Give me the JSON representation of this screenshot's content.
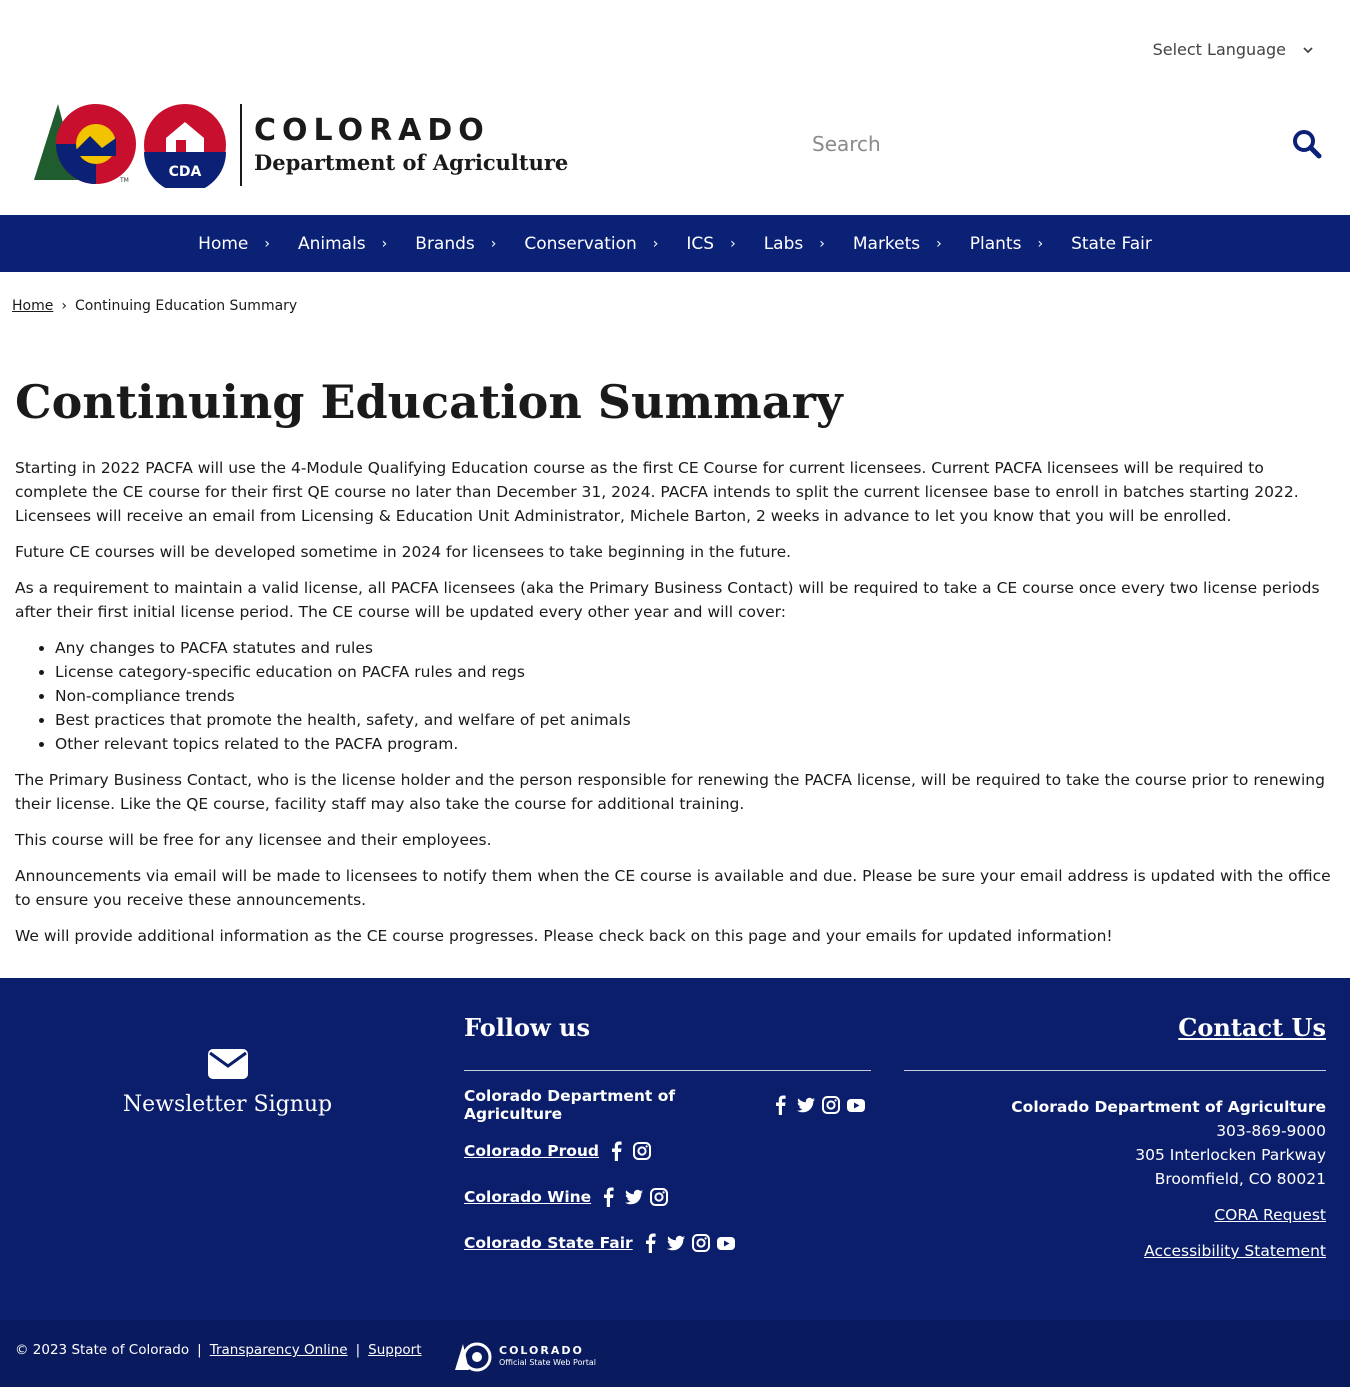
{
  "language": {
    "label": "Select Language"
  },
  "brand": {
    "name": "COLORADO",
    "dept": "Department of Agriculture",
    "badge": "CDA",
    "tm": "TM"
  },
  "search": {
    "placeholder": "Search"
  },
  "nav": {
    "items": [
      {
        "label": "Home"
      },
      {
        "label": "Animals"
      },
      {
        "label": "Brands"
      },
      {
        "label": "Conservation"
      },
      {
        "label": "ICS"
      },
      {
        "label": "Labs"
      },
      {
        "label": "Markets"
      },
      {
        "label": "Plants"
      },
      {
        "label": "State Fair"
      }
    ]
  },
  "breadcrumb": {
    "home": "Home",
    "current": "Continuing Education Summary"
  },
  "page": {
    "title": "Continuing Education Summary",
    "p1": "Starting in 2022 PACFA will use the 4-Module Qualifying Education course as the first CE Course for current licensees. Current PACFA licensees will be required to complete the CE course for their first QE course no later than December 31, 2024. PACFA intends to split the current licensee base to enroll in batches starting 2022.  Licensees will receive an email from Licensing & Education Unit Administrator, Michele Barton, 2 weeks in advance to let you know that you will be enrolled.",
    "p2": "Future CE courses will be developed sometime in 2024 for licensees to take beginning in the future.",
    "p3": "As a requirement to maintain a valid license, all PACFA licensees (aka the Primary Business Contact) will be required to take a CE course once every two license periods after their first initial license period. The CE course will be updated every other year and will cover:",
    "list": [
      "Any changes to PACFA statutes and rules",
      "License category-specific education on PACFA rules and regs",
      "Non-compliance trends",
      "Best practices that promote the health, safety, and welfare of pet animals",
      "Other relevant topics related to the PACFA program."
    ],
    "p4": "The Primary Business Contact, who is the license holder and the person responsible for renewing the PACFA license, will be required to take the course prior to renewing their license. Like the QE course, facility staff may also take the course for additional training.",
    "p5": "This course will be free for any licensee and their employees.",
    "p6": "Announcements via email will be made to licensees to notify them when the CE course is available and due. Please be sure your email address is updated with the office to ensure you receive these announcements.",
    "p7": "We will provide additional information as the CE course progresses. Please check back on this page and your emails for updated information!"
  },
  "footer": {
    "newsletter": "Newsletter Signup",
    "follow_title": "Follow us",
    "social": [
      {
        "label": "Colorado Department of Agriculture",
        "icons": [
          "facebook-icon",
          "twitter-icon",
          "instagram-icon",
          "youtube-icon"
        ]
      },
      {
        "label": "Colorado Proud",
        "icons": [
          "facebook-icon",
          "instagram-icon"
        ]
      },
      {
        "label": "Colorado Wine",
        "icons": [
          "facebook-icon",
          "twitter-icon",
          "instagram-icon"
        ]
      },
      {
        "label": "Colorado State Fair",
        "icons": [
          "facebook-icon",
          "twitter-icon",
          "instagram-icon",
          "youtube-icon"
        ]
      }
    ],
    "contact_title": "Contact Us",
    "org": "Colorado Department of Agriculture",
    "phone": "303-869-9000",
    "street": "305 Interlocken Parkway",
    "city": "Broomfield, CO 80021",
    "cora": "CORA Request",
    "accessibility": "Accessibility Statement"
  },
  "bottom": {
    "copyright": "© 2023 State of Colorado",
    "sep": "|",
    "transparency": "Transparency Online",
    "support": "Support",
    "portal_name": "COLORADO",
    "portal_sub": "Official State Web Portal"
  },
  "colors": {
    "nav_bg": "#0b2176",
    "footer_bg": "#0b1e6b",
    "bottom_bg": "#0a1a5e",
    "brand_red": "#c8102e",
    "brand_blue": "#0b2176",
    "brand_gold": "#f2c300"
  }
}
